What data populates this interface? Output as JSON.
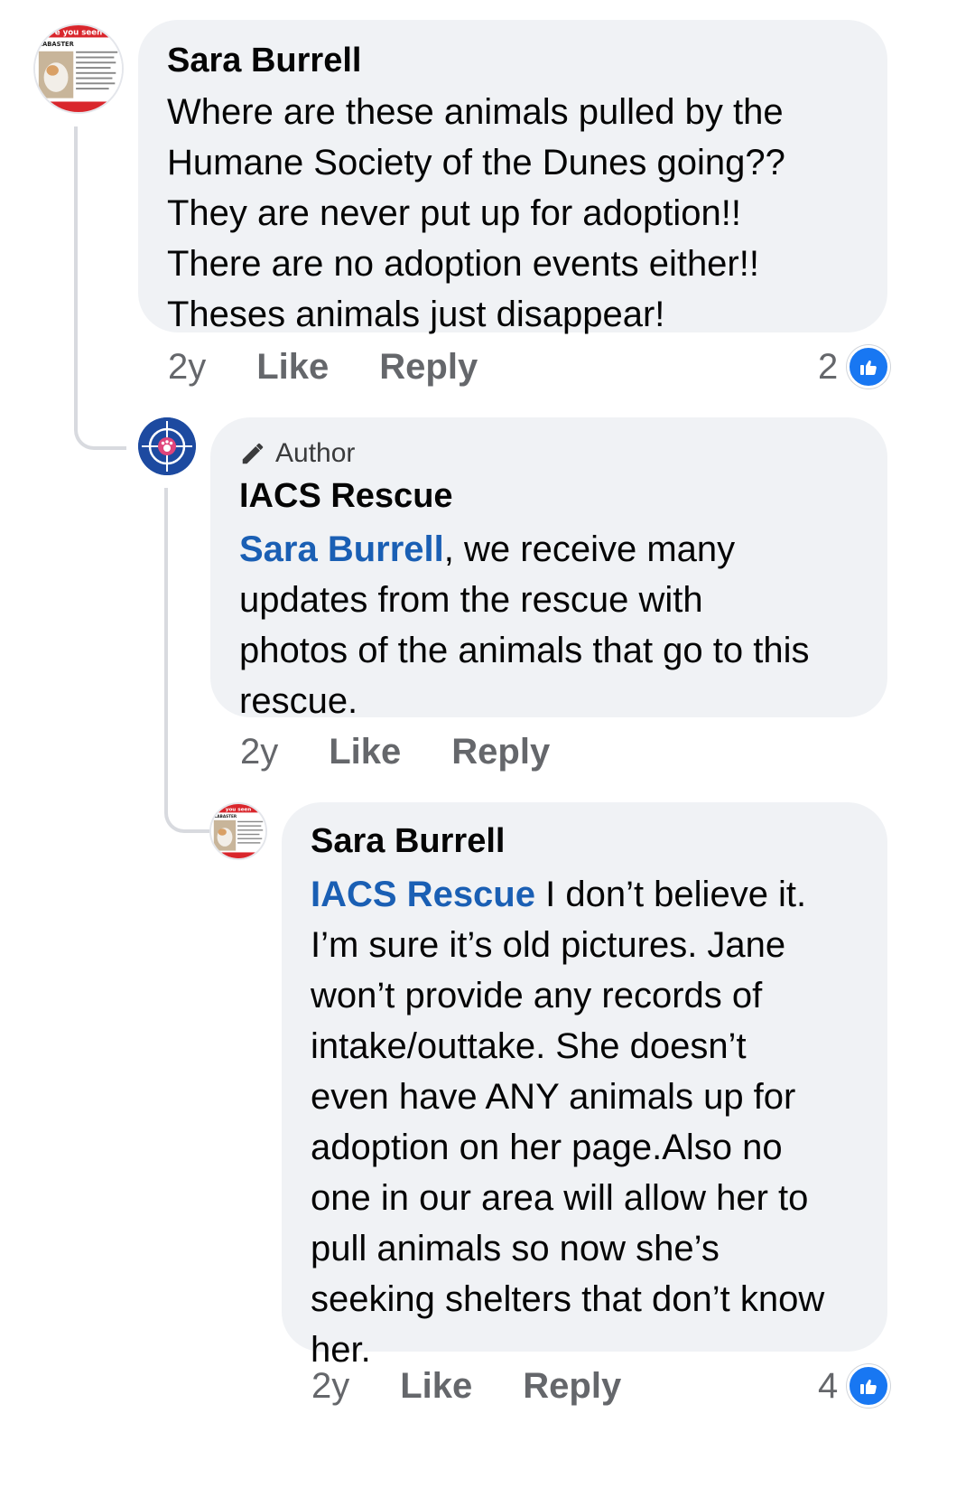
{
  "comments": [
    {
      "author": "Sara Burrell",
      "lines": [
        "Where are these animals pulled by the",
        "Humane Society of the Dunes going??",
        "They are never put up for adoption!!",
        "There are no adoption events either!!",
        "Theses animals just disappear!"
      ],
      "time": "2y",
      "like_label": "Like",
      "reply_label": "Reply",
      "reaction_count": "2",
      "avatar": {
        "banner_text": "e you seen",
        "title_text": "LABASTER",
        "description": "I am 1 of 115+ IACS animals pulled by Jane/Georgia Hultvee. My last known location was Humane Society of the Dunes in Chesterton, Indiana. If you have information on my whereabouts, reach"
      }
    },
    {
      "badge": "Author",
      "author": "IACS Rescue",
      "mention": "Sara Burrell",
      "lines": [
        ", we receive many",
        "updates from the rescue with",
        "photos of the animals that go to this",
        "rescue."
      ],
      "time": "2y",
      "like_label": "Like",
      "reply_label": "Reply"
    },
    {
      "author": "Sara Burrell",
      "mention": "IACS Rescue",
      "lines": [
        " I don’t believe it.",
        "I’m sure it’s old pictures. Jane",
        "won’t provide any records of",
        "intake/outtake. She doesn’t",
        "even have ANY animals up for",
        "adoption on her page.Also no",
        "one in our area will allow her to",
        "pull animals so now she’s",
        "seeking shelters that don’t know",
        "her."
      ],
      "time": "2y",
      "like_label": "Like",
      "reply_label": "Reply",
      "reaction_count": "4",
      "avatar": {
        "banner_text": "you seen",
        "title_text": "LABASTER"
      }
    }
  ],
  "colors": {
    "mention": "#1a5fb4",
    "like_blue": "#1877f2",
    "bubble": "#f0f2f5",
    "meta_text": "#65676b",
    "thread_line": "#d8dadf"
  }
}
